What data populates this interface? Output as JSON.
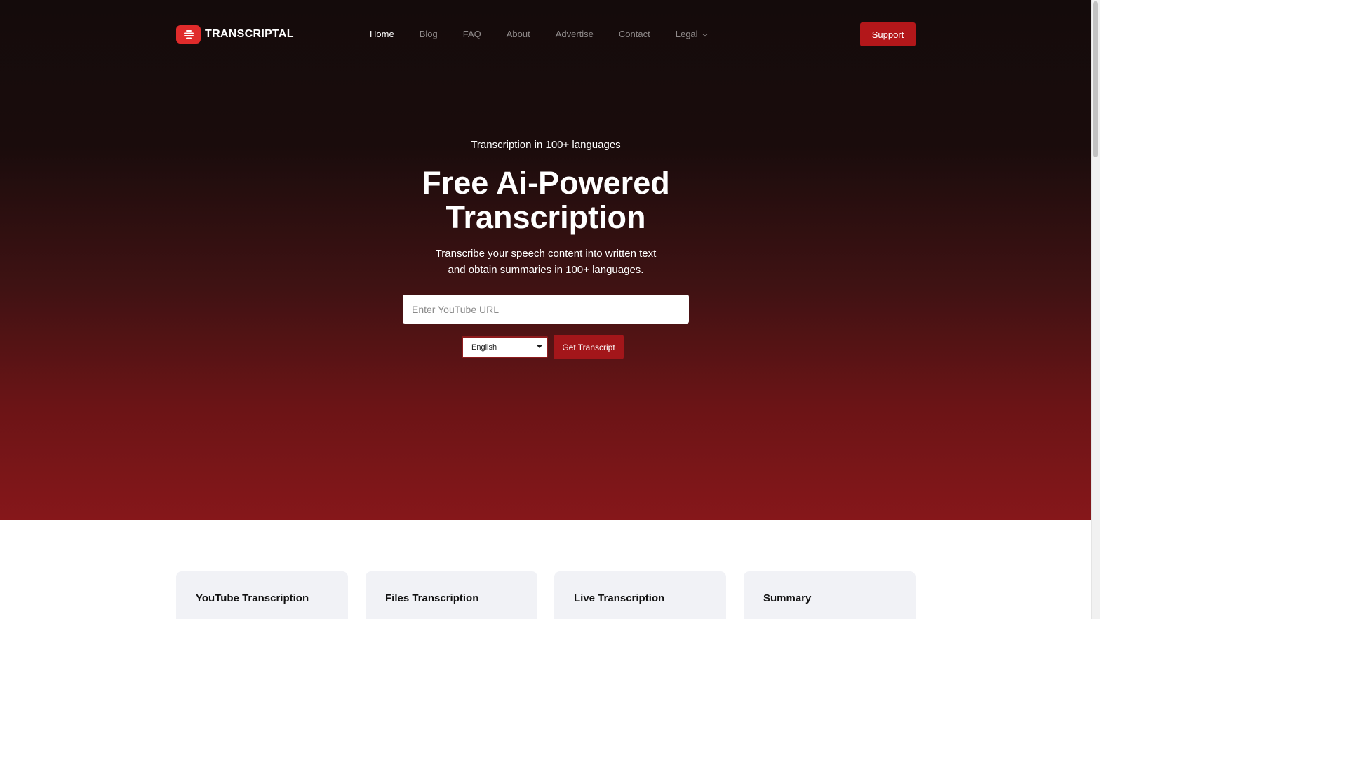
{
  "brand": {
    "name": "TRANSCRIPTAL",
    "accent_color": "#e02b2b"
  },
  "nav": {
    "items": [
      {
        "label": "Home",
        "active": true
      },
      {
        "label": "Blog",
        "active": false
      },
      {
        "label": "FAQ",
        "active": false
      },
      {
        "label": "About",
        "active": false
      },
      {
        "label": "Advertise",
        "active": false
      },
      {
        "label": "Contact",
        "active": false
      },
      {
        "label": "Legal",
        "active": false,
        "has_dropdown": true
      }
    ],
    "support_label": "Support"
  },
  "hero": {
    "kicker": "Transcription in 100+ languages",
    "headline_line1": "Free Ai-Powered",
    "headline_line2": "Transcription",
    "subtitle_line1": "Transcribe your speech content into written text",
    "subtitle_line2": "and obtain summaries in 100+ languages.",
    "url_placeholder": "Enter YouTube URL",
    "language_selected": "English",
    "submit_label": "Get Transcript"
  },
  "features": {
    "cards": [
      {
        "title": "YouTube Transcription"
      },
      {
        "title": "Files Transcription"
      },
      {
        "title": "Live Transcription"
      },
      {
        "title": "Summary"
      }
    ]
  }
}
